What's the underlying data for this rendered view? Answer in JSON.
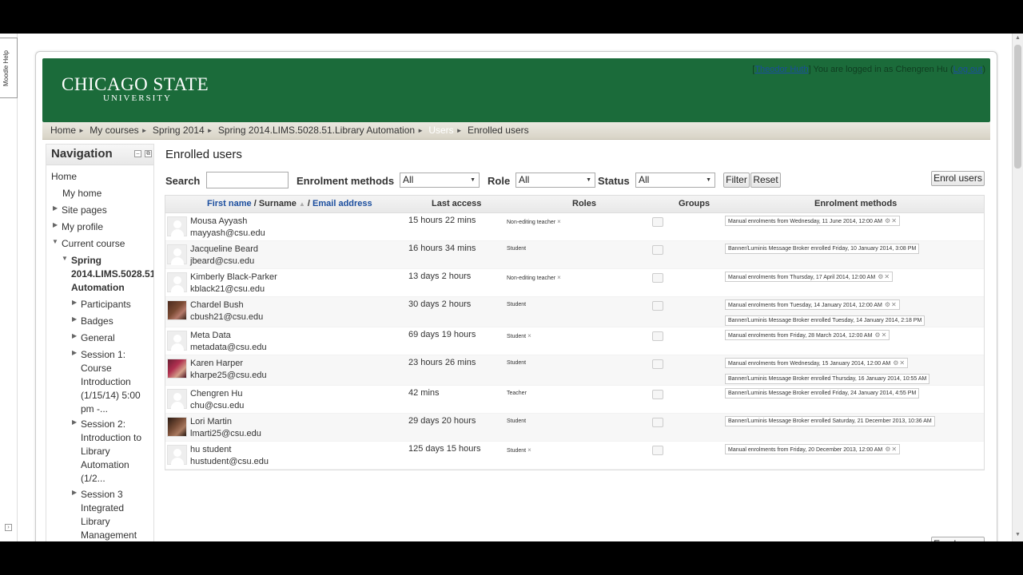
{
  "moodle_help": "Moodle Help",
  "header": {
    "logo_main": "CHICAGO STATE",
    "logo_sub": "UNIVERSITY",
    "login_prefix": "[",
    "switch_role_link": "Theodor Huth",
    "login_mid": "] You are logged in as Chengren Hu (",
    "logout_link": "Log out",
    "login_suffix": ")"
  },
  "breadcrumb": {
    "items": [
      "Home",
      "My courses",
      "Spring 2014",
      "Spring 2014.LIMS.5028.51.Library Automation",
      "Users",
      "Enrolled users"
    ]
  },
  "navigation": {
    "title": "Navigation",
    "home": "Home",
    "my_home": "My home",
    "site_pages": "Site pages",
    "my_profile": "My profile",
    "current_course": "Current course",
    "course_line1": "Spring",
    "course_line2": "2014.LIMS.5028.51.",
    "course_line3": "Automation",
    "participants": "Participants",
    "badges": "Badges",
    "general": "General",
    "session1": [
      "Session 1:",
      "Course",
      "Introduction",
      "(1/15/14) 5:00",
      "pm -..."
    ],
    "session2": [
      "Session 2:",
      "Introduction to",
      "Library",
      "Automation",
      "(1/2..."
    ],
    "session3": [
      "Session 3",
      "Integrated",
      "Library",
      "Management"
    ]
  },
  "main": {
    "title": "Enrolled users",
    "filters": {
      "search_label": "Search",
      "search_value": "",
      "enrolment_label": "Enrolment methods",
      "enrolment_value": "All",
      "role_label": "Role",
      "role_value": "All",
      "status_label": "Status",
      "status_value": "All",
      "filter_button": "Filter",
      "reset_button": "Reset"
    },
    "enrol_users_button": "Enrol users",
    "table": {
      "headers": {
        "firstname": "First name",
        "slash1": " / ",
        "surname": "Surname",
        "slash2": " / ",
        "email": "Email address",
        "last_access": "Last access",
        "roles": "Roles",
        "groups": "Groups",
        "enrolment_methods": "Enrolment methods"
      },
      "rows": [
        {
          "name": "Mousa Ayyash",
          "email": "mayyash@csu.edu",
          "last_access": "15 hours 22 mins",
          "role": "Non-editing teacher",
          "role_x": "×",
          "enrolments": [
            "Manual enrolments from Wednesday, 11 June 2014, 12:00 AM"
          ]
        },
        {
          "name": "Jacqueline Beard",
          "email": "jbeard@csu.edu",
          "last_access": "16 hours 34 mins",
          "role": "Student",
          "role_x": "",
          "enrolments": [
            "Banner/Luminis Message Broker enrolled Friday, 10 January 2014, 3:08 PM"
          ]
        },
        {
          "name": "Kimberly Black-Parker",
          "email": "kblack21@csu.edu",
          "last_access": "13 days 2 hours",
          "role": "Non-editing teacher",
          "role_x": "×",
          "enrolments": [
            "Manual enrolments from Thursday, 17 April 2014, 12:00 AM"
          ]
        },
        {
          "name": "Chardel Bush",
          "email": "cbush21@csu.edu",
          "last_access": "30 days 2 hours",
          "role": "Student",
          "role_x": "",
          "enrolments": [
            "Manual enrolments from Tuesday, 14 January 2014, 12:00 AM",
            "Banner/Luminis Message Broker enrolled Tuesday, 14 January 2014, 2:18 PM"
          ]
        },
        {
          "name": "Meta Data",
          "email": "metadata@csu.edu",
          "last_access": "69 days 19 hours",
          "role": "Student",
          "role_x": "×",
          "enrolments": [
            "Manual enrolments from Friday, 28 March 2014, 12:00 AM"
          ]
        },
        {
          "name": "Karen Harper",
          "email": "kharpe25@csu.edu",
          "last_access": "23 hours 26 mins",
          "role": "Student",
          "role_x": "",
          "enrolments": [
            "Manual enrolments from Wednesday, 15 January 2014, 12:00 AM",
            "Banner/Luminis Message Broker enrolled Thursday, 16 January 2014, 10:55 AM"
          ]
        },
        {
          "name": "Chengren Hu",
          "email": "chu@csu.edu",
          "last_access": "42 mins",
          "role": "Teacher",
          "role_x": "",
          "enrolments": [
            "Banner/Luminis Message Broker enrolled Friday, 24 January 2014, 4:55 PM"
          ]
        },
        {
          "name": "Lori Martin",
          "email": "lmarti25@csu.edu",
          "last_access": "29 days 20 hours",
          "role": "Student",
          "role_x": "",
          "enrolments": [
            "Banner/Luminis Message Broker enrolled Saturday, 21 December 2013, 10:36 AM"
          ]
        },
        {
          "name": "hu student",
          "email": "hustudent@csu.edu",
          "last_access": "125 days 15 hours",
          "role": "Student",
          "role_x": "×",
          "enrolments": [
            "Manual enrolments from Friday, 20 December 2013, 12:00 AM"
          ]
        }
      ]
    }
  },
  "colors": {
    "header_green": "#1b6b3a",
    "link_blue": "#1a4d9e"
  }
}
